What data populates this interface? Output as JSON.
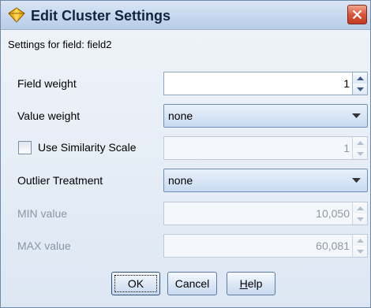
{
  "dialog": {
    "title": "Edit Cluster Settings",
    "settings_for": "Settings for field: field2"
  },
  "fields": {
    "field_weight": {
      "label": "Field weight",
      "value": "1"
    },
    "value_weight": {
      "label": "Value weight",
      "selected": "none"
    },
    "use_similarity_scale": {
      "label": "Use Similarity Scale",
      "checked": false,
      "value": "1"
    },
    "outlier_treatment": {
      "label": "Outlier Treatment",
      "selected": "none"
    },
    "min_value": {
      "label": "MIN value",
      "value": "10,050"
    },
    "max_value": {
      "label": "MAX value",
      "value": "60,081"
    }
  },
  "buttons": {
    "ok": "OK",
    "cancel": "Cancel",
    "help_prefix": "H",
    "help_rest": "elp"
  },
  "colors": {
    "accent": "#c9daf0",
    "close_button": "#c23b22",
    "disabled_text": "#8a96a6"
  },
  "icons": {
    "app": "cluster-diamond-icon",
    "close": "close-icon",
    "spin_up": "spin-up-arrow-icon",
    "spin_down": "spin-down-arrow-icon",
    "dropdown": "chevron-down-icon"
  }
}
